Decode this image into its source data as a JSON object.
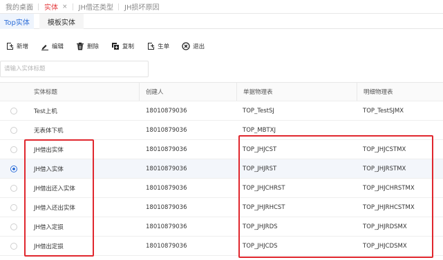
{
  "top_tabs": [
    {
      "label": "我的桌面"
    },
    {
      "label": "实体",
      "close": "×"
    },
    {
      "label": "JH借还类型"
    },
    {
      "label": "JH损坏原因"
    }
  ],
  "sub_tabs": [
    {
      "label": "Top实体"
    },
    {
      "label": "模板实体"
    }
  ],
  "toolbar": {
    "add": "新增",
    "edit": "编辑",
    "delete": "删除",
    "copy": "复制",
    "generate": "生单",
    "exit": "退出"
  },
  "search": {
    "placeholder": "请输入实体标题"
  },
  "table": {
    "headers": [
      "实体标题",
      "创建人",
      "单据物理表",
      "明细物理表"
    ],
    "rows": [
      {
        "title": "Test上机",
        "creator": "18010879036",
        "bill_table": "TOP_TestSJ",
        "detail_table": "TOP_TestSJMX",
        "selected": false
      },
      {
        "title": "无表体下机",
        "creator": "18010879036",
        "bill_table": "TOP_MBTXJ",
        "detail_table": "",
        "selected": false
      },
      {
        "title": "JH借出实体",
        "creator": "18010879036",
        "bill_table": "TOP_JHJCST",
        "detail_table": "TOP_JHJCSTMX",
        "selected": false
      },
      {
        "title": "JH借入实体",
        "creator": "18010879036",
        "bill_table": "TOP_JHJRST",
        "detail_table": "TOP_JHJRSTMX",
        "selected": true
      },
      {
        "title": "JH借出还入实体",
        "creator": "18010879036",
        "bill_table": "TOP_JHJCHRST",
        "detail_table": "TOP_JHJCHRSTMX",
        "selected": false
      },
      {
        "title": "JH借入还出实体",
        "creator": "18010879036",
        "bill_table": "TOP_JHJRHCST",
        "detail_table": "TOP_JHJRHCSTMX",
        "selected": false
      },
      {
        "title": "JH借入定损",
        "creator": "18010879036",
        "bill_table": "TOP_JHJRDS",
        "detail_table": "TOP_JHJRDSMX",
        "selected": false
      },
      {
        "title": "JH借出定损",
        "creator": "18010879036",
        "bill_table": "TOP_JHJCDS",
        "detail_table": "TOP_JHJCDSMX",
        "selected": false
      }
    ]
  },
  "colors": {
    "accent": "#2f6fd8",
    "active_tab": "#e4393c",
    "highlight": "#e0262d"
  }
}
